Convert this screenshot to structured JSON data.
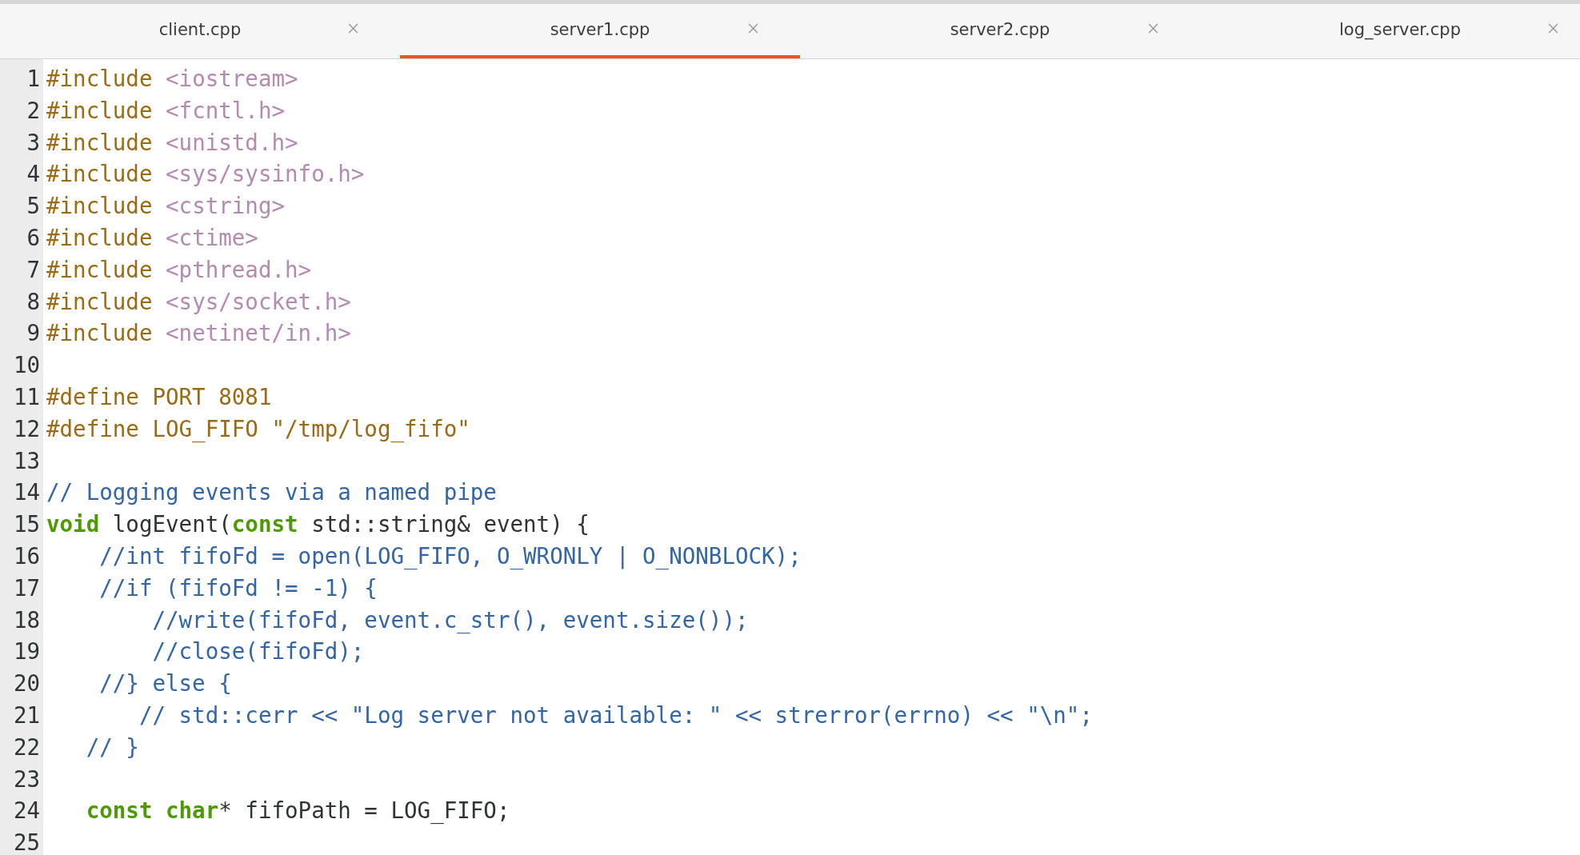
{
  "tabs": [
    {
      "label": "client.cpp",
      "selected": false
    },
    {
      "label": "server1.cpp",
      "selected": true
    },
    {
      "label": "server2.cpp",
      "selected": false
    },
    {
      "label": "log_server.cpp",
      "selected": false
    }
  ],
  "editor": {
    "lines": [
      {
        "number": "1",
        "tokens": [
          {
            "kind": "preproc",
            "text": "#include "
          },
          {
            "kind": "path",
            "text": "<iostream>"
          }
        ]
      },
      {
        "number": "2",
        "tokens": [
          {
            "kind": "preproc",
            "text": "#include "
          },
          {
            "kind": "path",
            "text": "<fcntl.h>"
          }
        ]
      },
      {
        "number": "3",
        "tokens": [
          {
            "kind": "preproc",
            "text": "#include "
          },
          {
            "kind": "path",
            "text": "<unistd.h>"
          }
        ]
      },
      {
        "number": "4",
        "tokens": [
          {
            "kind": "preproc",
            "text": "#include "
          },
          {
            "kind": "path",
            "text": "<sys/sysinfo.h>"
          }
        ]
      },
      {
        "number": "5",
        "tokens": [
          {
            "kind": "preproc",
            "text": "#include "
          },
          {
            "kind": "path",
            "text": "<cstring>"
          }
        ]
      },
      {
        "number": "6",
        "tokens": [
          {
            "kind": "preproc",
            "text": "#include "
          },
          {
            "kind": "path",
            "text": "<ctime>"
          }
        ]
      },
      {
        "number": "7",
        "tokens": [
          {
            "kind": "preproc",
            "text": "#include "
          },
          {
            "kind": "path",
            "text": "<pthread.h>"
          }
        ]
      },
      {
        "number": "8",
        "tokens": [
          {
            "kind": "preproc",
            "text": "#include "
          },
          {
            "kind": "path",
            "text": "<sys/socket.h>"
          }
        ]
      },
      {
        "number": "9",
        "tokens": [
          {
            "kind": "preproc",
            "text": "#include "
          },
          {
            "kind": "path",
            "text": "<netinet/in.h>"
          }
        ]
      },
      {
        "number": "10"
      },
      {
        "number": "11",
        "tokens": [
          {
            "kind": "preproc",
            "text": "#define PORT 8081"
          }
        ]
      },
      {
        "number": "12",
        "tokens": [
          {
            "kind": "preproc",
            "text": "#define LOG_FIFO \"/tmp/log_fifo\""
          }
        ]
      },
      {
        "number": "13"
      },
      {
        "number": "14",
        "tokens": [
          {
            "kind": "comment",
            "text": "// Logging events via a named pipe"
          }
        ]
      },
      {
        "number": "15",
        "tokens": [
          {
            "kind": "keyword",
            "text": "void"
          },
          {
            "kind": "plain",
            "text": " logEvent("
          },
          {
            "kind": "keyword",
            "text": "const"
          },
          {
            "kind": "plain",
            "text": " std::string& event) {"
          }
        ]
      },
      {
        "number": "16",
        "tokens": [
          {
            "kind": "comment",
            "text": "    //int fifoFd = open(LOG_FIFO, O_WRONLY | O_NONBLOCK);"
          }
        ]
      },
      {
        "number": "17",
        "tokens": [
          {
            "kind": "comment",
            "text": "    //if (fifoFd != -1) {"
          }
        ]
      },
      {
        "number": "18",
        "tokens": [
          {
            "kind": "comment",
            "text": "        //write(fifoFd, event.c_str(), event.size());"
          }
        ]
      },
      {
        "number": "19",
        "tokens": [
          {
            "kind": "comment",
            "text": "        //close(fifoFd);"
          }
        ]
      },
      {
        "number": "20",
        "tokens": [
          {
            "kind": "comment",
            "text": "    //} else {"
          }
        ]
      },
      {
        "number": "21",
        "tokens": [
          {
            "kind": "comment",
            "text": "       // std::cerr << \"Log server not available: \" << strerror(errno) << \"\\n\";"
          }
        ]
      },
      {
        "number": "22",
        "tokens": [
          {
            "kind": "comment",
            "text": "   // }"
          }
        ]
      },
      {
        "number": "23"
      },
      {
        "number": "24",
        "tokens": [
          {
            "kind": "keyword",
            "text": "   const char"
          },
          {
            "kind": "plain",
            "text": "* fifoPath = LOG_FIFO;"
          }
        ]
      },
      {
        "number": "25"
      }
    ]
  }
}
